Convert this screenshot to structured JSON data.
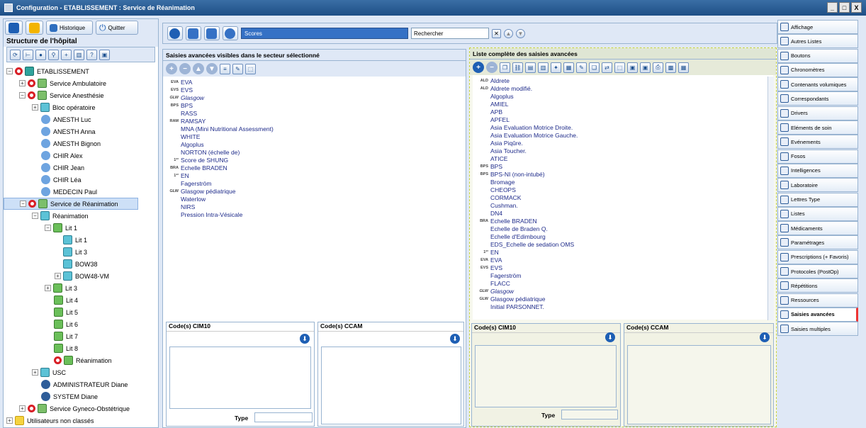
{
  "window": {
    "title": "Configuration - ETABLISSEMENT : Service de Réanimation",
    "min": "_",
    "max": "□",
    "close": "X"
  },
  "left": {
    "history_label": "Historique",
    "quit_label": "Quitter",
    "group_title": "Structure de l'hôpital",
    "tree": [
      {
        "label": "ETABLISSEMENT"
      },
      {
        "label": "Service Ambulatoire"
      },
      {
        "label": "Service Anesthésie"
      },
      {
        "label": "Bloc opératoire"
      },
      {
        "label": "ANESTH Luc"
      },
      {
        "label": "ANESTH Anna"
      },
      {
        "label": "ANESTH Bignon"
      },
      {
        "label": "CHIR Alex"
      },
      {
        "label": "CHIR Jean"
      },
      {
        "label": "CHIR Léa"
      },
      {
        "label": "MEDECIN Paul"
      },
      {
        "label": "Service de Réanimation"
      },
      {
        "label": "Réanimation"
      },
      {
        "label": "Lit 1"
      },
      {
        "label": "Lit 1"
      },
      {
        "label": "Lit 3"
      },
      {
        "label": "BOW38"
      },
      {
        "label": "BOW48-VM"
      },
      {
        "label": "Lit 3"
      },
      {
        "label": "Lit 4"
      },
      {
        "label": "Lit 5"
      },
      {
        "label": "Lit 6"
      },
      {
        "label": "Lit 7"
      },
      {
        "label": "Lit 8"
      },
      {
        "label": "Réanimation"
      },
      {
        "label": "USC"
      },
      {
        "label": "ADMINISTRATEUR Diane"
      },
      {
        "label": "SYSTEM Diane"
      },
      {
        "label": "Service Gyneco-Obstétrique"
      },
      {
        "label": "Utilisateurs non classés"
      }
    ]
  },
  "toolbar": {
    "scores_value": "Scores",
    "search_placeholder": "Rechercher"
  },
  "visible_panel": {
    "title": "Saisies avancées visibles dans le secteur sélectionné",
    "items": [
      {
        "pfx": "EVA",
        "label": "EVA"
      },
      {
        "pfx": "EVS",
        "label": "EVS"
      },
      {
        "pfx": "GLW",
        "label": "Glasgow"
      },
      {
        "pfx": "BPS",
        "label": "BPS"
      },
      {
        "pfx": "",
        "label": "RASS"
      },
      {
        "pfx": "RAM",
        "label": "RAMSAY"
      },
      {
        "pfx": "",
        "label": "MNA (Mini Nutritional Assessment)"
      },
      {
        "pfx": "",
        "label": "WHITE"
      },
      {
        "pfx": "",
        "label": "Algoplus"
      },
      {
        "pfx": "",
        "label": "NORTON (échelle de)"
      },
      {
        "pfx": "1²³",
        "label": "Score de SHUNG"
      },
      {
        "pfx": "BRA",
        "label": "Echelle BRADEN"
      },
      {
        "pfx": "1²³",
        "label": "EN"
      },
      {
        "pfx": "",
        "label": "Fagerström"
      },
      {
        "pfx": "GLW",
        "label": "Glasgow pédiatrique"
      },
      {
        "pfx": "",
        "label": "Waterlow"
      },
      {
        "pfx": "",
        "label": "NIRS"
      },
      {
        "pfx": "",
        "label": "Pression Intra-Vésicale"
      }
    ],
    "cim10_label": "Code(s) CIM10",
    "ccam_label": "Code(s) CCAM",
    "type_label": "Type"
  },
  "complete_panel": {
    "title": "Liste complète des saisies avancées",
    "items": [
      {
        "pfx": "ALD",
        "label": "Aldrete"
      },
      {
        "pfx": "ALD",
        "label": "Aldrete modifié."
      },
      {
        "pfx": "",
        "label": "Algoplus"
      },
      {
        "pfx": "",
        "label": "AMIEL"
      },
      {
        "pfx": "",
        "label": "APB"
      },
      {
        "pfx": "",
        "label": "APFEL"
      },
      {
        "pfx": "",
        "label": "Asia Evaluation Motrice Droite."
      },
      {
        "pfx": "",
        "label": "Asia Evaluation Motrice Gauche."
      },
      {
        "pfx": "",
        "label": "Asia Piqûre."
      },
      {
        "pfx": "",
        "label": "Asia Toucher."
      },
      {
        "pfx": "",
        "label": "ATICE"
      },
      {
        "pfx": "BPS",
        "label": "BPS"
      },
      {
        "pfx": "BPS",
        "label": "BPS-NI (non-intubé)"
      },
      {
        "pfx": "",
        "label": "Bromage"
      },
      {
        "pfx": "",
        "label": "CHEOPS"
      },
      {
        "pfx": "",
        "label": "CORMACK"
      },
      {
        "pfx": "",
        "label": "Cushman."
      },
      {
        "pfx": "",
        "label": "DN4"
      },
      {
        "pfx": "BRA",
        "label": "Echelle BRADEN"
      },
      {
        "pfx": "",
        "label": "Echelle de Braden Q."
      },
      {
        "pfx": "",
        "label": "Echelle d'Edimbourg"
      },
      {
        "pfx": "",
        "label": "EDS_Echelle de sedation OMS"
      },
      {
        "pfx": "1²³",
        "label": "EN"
      },
      {
        "pfx": "EVA",
        "label": "EVA"
      },
      {
        "pfx": "EVS",
        "label": "EVS"
      },
      {
        "pfx": "",
        "label": "Fagerström"
      },
      {
        "pfx": "",
        "label": "FLACC"
      },
      {
        "pfx": "GLW",
        "label": "Glasgow"
      },
      {
        "pfx": "GLW",
        "label": "Glasgow pédiatrique"
      },
      {
        "pfx": "",
        "label": "Initial PARSONNET."
      }
    ],
    "cim10_label": "Code(s) CIM10",
    "ccam_label": "Code(s) CCAM",
    "type_label": "Type"
  },
  "right_tabs": [
    "Affichage",
    "Autres Listes",
    "Boutons",
    "Chronomètres",
    "Contenants volumiques",
    "Correspondants",
    "Drivers",
    "Eléments de soin",
    "Evénements",
    "Fosos",
    "Intelligences",
    "Laboratoire",
    "Lettres Type",
    "Listes",
    "Médicaments",
    "Paramétrages",
    "Prescriptions (+ Favoris)",
    "Protocoles (PostOp)",
    "Répétitions",
    "Ressources",
    "Saisies avancées",
    "Saisies multiples"
  ]
}
